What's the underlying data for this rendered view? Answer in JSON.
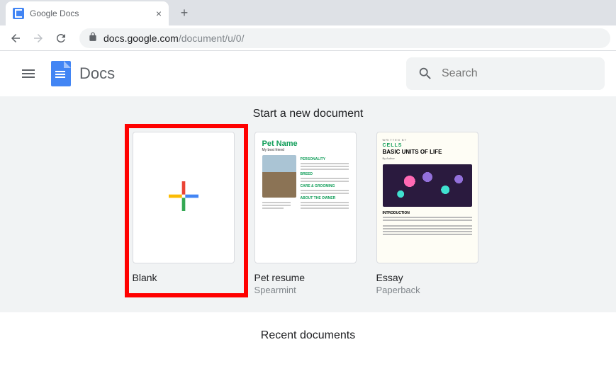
{
  "browser": {
    "tab_title": "Google Docs",
    "url_host": "docs.google.com",
    "url_path": "/document/u/0/"
  },
  "header": {
    "app_title": "Docs",
    "search_placeholder": "Search"
  },
  "templates": {
    "section_title": "Start a new document",
    "items": [
      {
        "name": "Blank",
        "subtitle": ""
      },
      {
        "name": "Pet resume",
        "subtitle": "Spearmint"
      },
      {
        "name": "Essay",
        "subtitle": "Paperback"
      }
    ],
    "pet_preview": {
      "title": "Pet Name",
      "subtitle": "My best friend"
    },
    "essay_preview": {
      "category": "CELLS",
      "title": "BASIC UNITS OF LIFE",
      "intro": "INTRODUCTION"
    }
  },
  "recent": {
    "title": "Recent documents"
  }
}
